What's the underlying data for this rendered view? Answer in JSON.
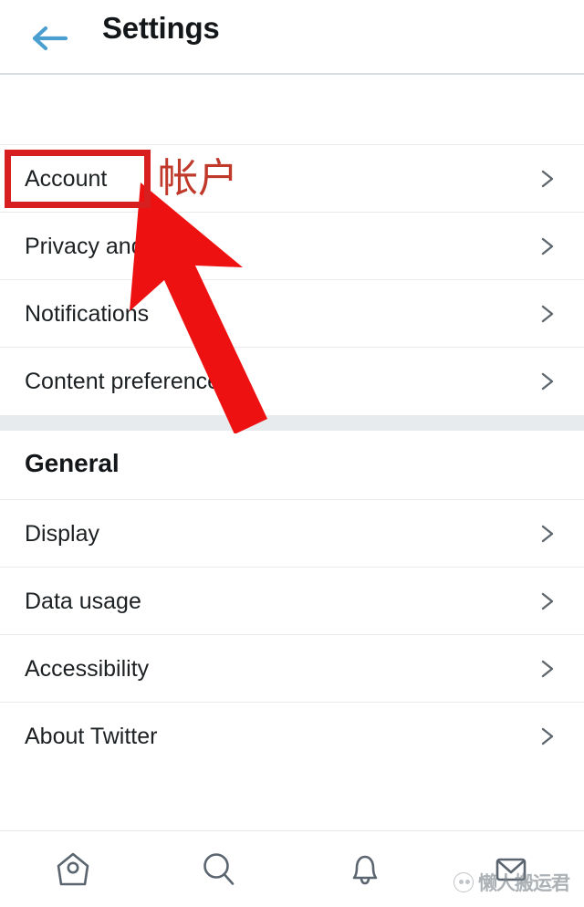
{
  "header": {
    "title": "Settings",
    "back_icon": "arrow-left-icon",
    "back_color": "#4a9fd0",
    "divider_color": "#d9dde0"
  },
  "sections": [
    {
      "id": "account",
      "heading": "",
      "rows": [
        {
          "label": "Account",
          "chevron": "chevron-right-icon"
        },
        {
          "label": "Privacy and s",
          "chevron": "chevron-right-icon"
        },
        {
          "label": "Notifications",
          "chevron": "chevron-right-icon"
        },
        {
          "label": "Content preferences",
          "chevron": "chevron-right-icon"
        }
      ]
    },
    {
      "id": "general",
      "heading": "General",
      "rows": [
        {
          "label": "Display",
          "chevron": "chevron-right-icon"
        },
        {
          "label": "Data usage",
          "chevron": "chevron-right-icon"
        },
        {
          "label": "Accessibility",
          "chevron": "chevron-right-icon"
        },
        {
          "label": "About Twitter",
          "chevron": "chevron-right-icon"
        }
      ]
    }
  ],
  "bottom_nav": {
    "items": [
      {
        "icon": "home-icon",
        "label": "Home"
      },
      {
        "icon": "search-icon",
        "label": "Search"
      },
      {
        "icon": "bell-icon",
        "label": "Notifications"
      },
      {
        "icon": "envelope-icon",
        "label": "Messages"
      }
    ],
    "icon_color": "#5b6570"
  },
  "annotations": {
    "highlight_box": {
      "target": "Account",
      "color": "#d81f1f"
    },
    "chinese_label": {
      "text": "帐户",
      "color": "#c0392b"
    },
    "arrow": {
      "icon": "arrow-up-left-icon",
      "color": "#ee1111",
      "points_to": "Account"
    }
  },
  "watermark": {
    "text": "懒人搬运君",
    "logo_icon": "face-logo-icon",
    "color": "#7a8288"
  }
}
